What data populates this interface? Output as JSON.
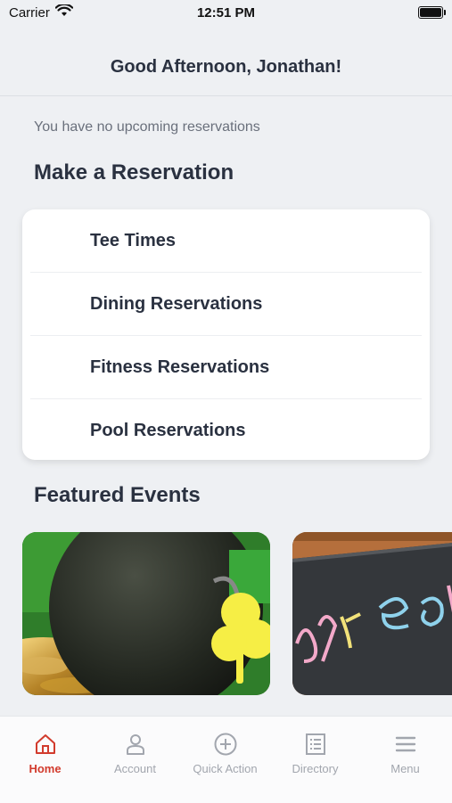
{
  "status_bar": {
    "carrier": "Carrier",
    "time": "12:51 PM"
  },
  "header": {
    "greeting": "Good Afternoon, Jonathan!"
  },
  "reservations": {
    "status_text": "You have no upcoming reservations",
    "section_title": "Make a Reservation",
    "items": [
      {
        "label": "Tee Times"
      },
      {
        "label": "Dining Reservations"
      },
      {
        "label": "Fitness Reservations"
      },
      {
        "label": "Pool Reservations"
      }
    ]
  },
  "events": {
    "section_title": "Featured Events"
  },
  "tab_bar": {
    "active_color": "#d23b2d",
    "inactive_color": "#a2a6ae",
    "tabs": [
      {
        "label": "Home",
        "icon": "home-icon"
      },
      {
        "label": "Account",
        "icon": "account-icon"
      },
      {
        "label": "Quick Action",
        "icon": "plus-circle-icon"
      },
      {
        "label": "Directory",
        "icon": "directory-icon"
      },
      {
        "label": "Menu",
        "icon": "menu-icon"
      }
    ]
  }
}
